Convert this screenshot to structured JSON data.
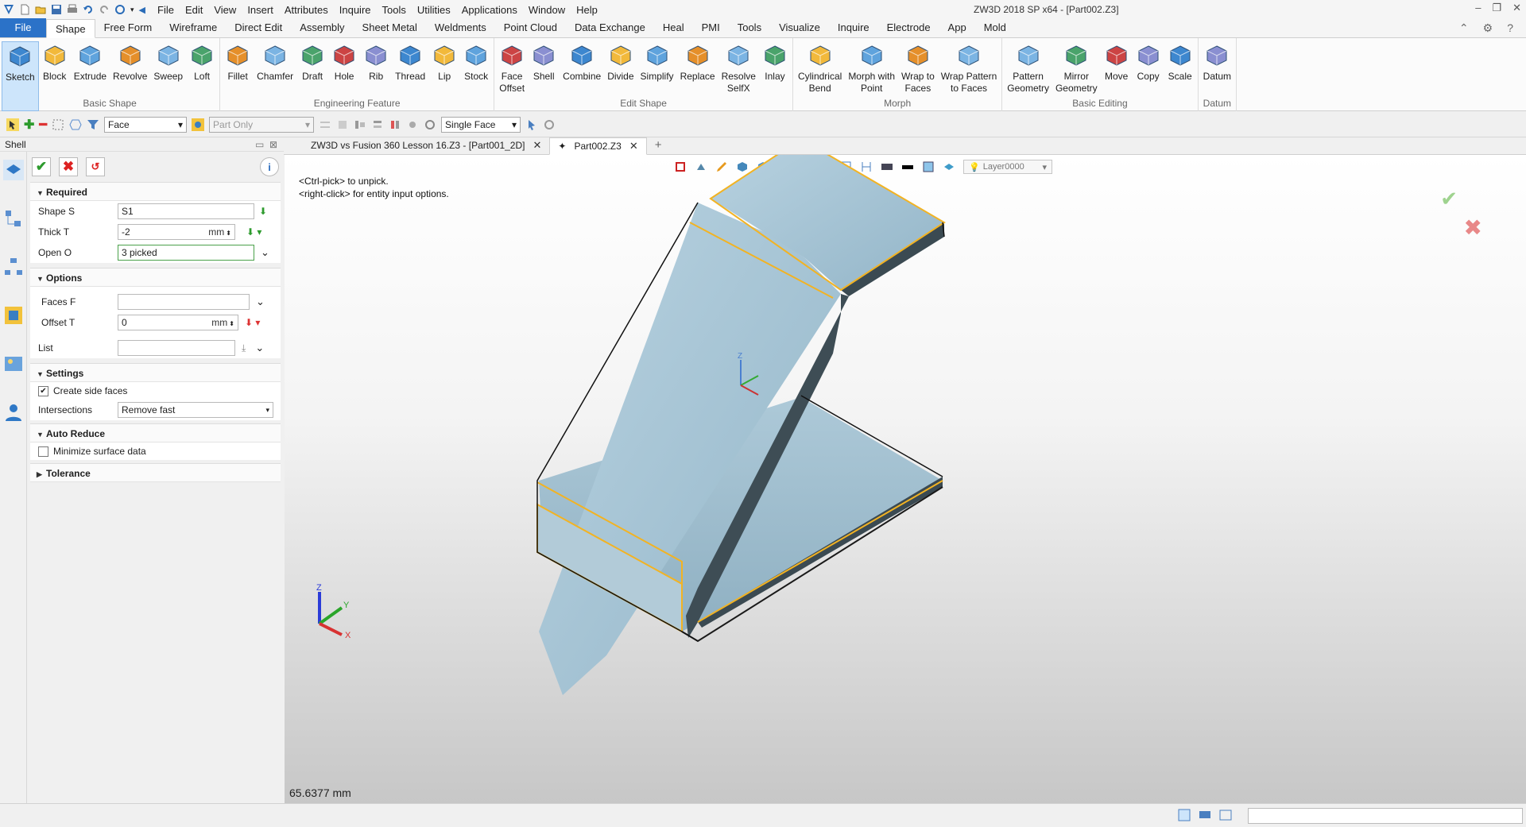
{
  "app": {
    "window_title": "ZW3D 2018 SP x64 - [Part002.Z3]",
    "menu": [
      "File",
      "Edit",
      "View",
      "Insert",
      "Attributes",
      "Inquire",
      "Tools",
      "Utilities",
      "Applications",
      "Window",
      "Help"
    ]
  },
  "ribbon_tabs": [
    "File",
    "Shape",
    "Free Form",
    "Wireframe",
    "Direct Edit",
    "Assembly",
    "Sheet Metal",
    "Weldments",
    "Point Cloud",
    "Data Exchange",
    "Heal",
    "PMI",
    "Tools",
    "Visualize",
    "Inquire",
    "Electrode",
    "App",
    "Mold"
  ],
  "ribbon_active_tab": "Shape",
  "ribbon_groups": [
    {
      "label": "Basic Shape",
      "tools": [
        "Sketch",
        "Block",
        "Extrude",
        "Revolve",
        "Sweep",
        "Loft"
      ]
    },
    {
      "label": "Engineering Feature",
      "tools": [
        "Fillet",
        "Chamfer",
        "Draft",
        "Hole",
        "Rib",
        "Thread",
        "Lip",
        "Stock"
      ]
    },
    {
      "label": "Edit Shape",
      "tools": [
        "Face\nOffset",
        "Shell",
        "Combine",
        "Divide",
        "Simplify",
        "Replace",
        "Resolve\nSelfX",
        "Inlay"
      ]
    },
    {
      "label": "Morph",
      "tools": [
        "Cylindrical\nBend",
        "Morph with\nPoint",
        "Wrap to\nFaces",
        "Wrap Pattern\nto Faces"
      ]
    },
    {
      "label": "Basic Editing",
      "tools": [
        "Pattern\nGeometry",
        "Mirror\nGeometry",
        "Move",
        "Copy",
        "Scale"
      ]
    },
    {
      "label": "Datum",
      "tools": [
        "Datum"
      ]
    }
  ],
  "toolbar2": {
    "filter": "Face",
    "scope": "Part Only",
    "pick_mode": "Single Face"
  },
  "panel": {
    "title": "Shell",
    "required": {
      "header": "Required",
      "shape_label": "Shape S",
      "shape_value": "S1",
      "thick_label": "Thick T",
      "thick_value": "-2",
      "thick_unit": "mm",
      "open_label": "Open O",
      "open_value": "3 picked"
    },
    "options": {
      "header": "Options",
      "faces_label": "Faces F",
      "faces_value": "",
      "offset_label": "Offset T",
      "offset_value": "0",
      "offset_unit": "mm",
      "list_label": "List",
      "list_value": ""
    },
    "settings": {
      "header": "Settings",
      "create_side_faces": "Create side faces",
      "create_side_faces_checked": true,
      "intersections_label": "Intersections",
      "intersections_value": "Remove fast"
    },
    "auto_reduce": {
      "header": "Auto Reduce",
      "minimize": "Minimize surface data",
      "minimize_checked": false
    },
    "tolerance": {
      "header": "Tolerance"
    }
  },
  "doc_tabs": [
    {
      "label": "ZW3D vs Fusion 360 Lesson 16.Z3 - [Part001_2D]",
      "active": false
    },
    {
      "label": "Part002.Z3",
      "active": true
    }
  ],
  "viewport": {
    "hint_line1": "<Ctrl-pick> to unpick.",
    "hint_line2": "<right-click> for entity input options.",
    "layer": "Layer0000",
    "distance": "65.6377 mm",
    "axis_x": "X",
    "axis_y": "Y",
    "axis_z": "Z"
  },
  "colors": {
    "part_face": "#a9c6d6",
    "part_edge_dark": "#3b4a52",
    "selection": "#f2b323",
    "file_tab": "#2b72c8"
  }
}
